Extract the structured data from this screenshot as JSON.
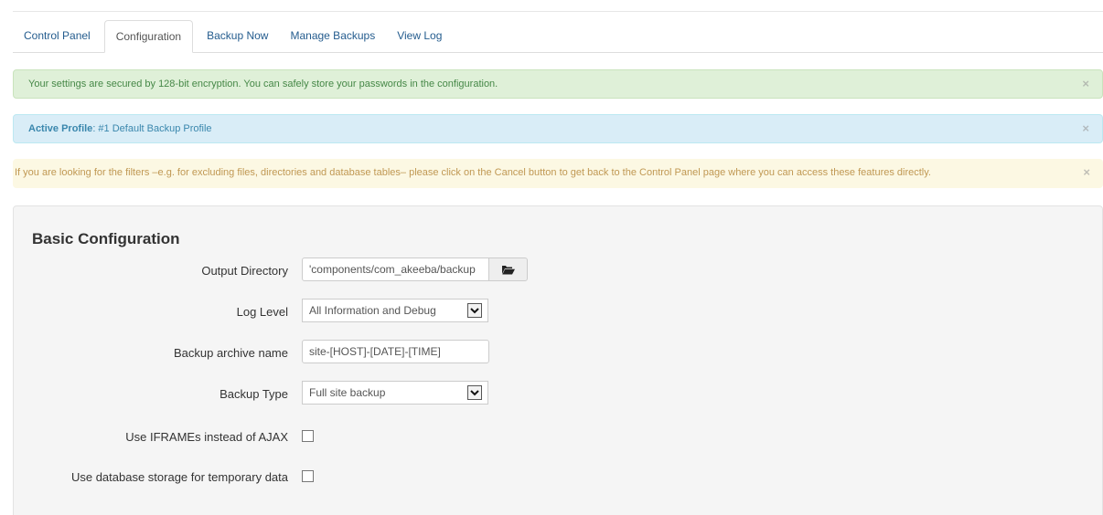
{
  "tabs": [
    {
      "label": "Control Panel"
    },
    {
      "label": "Configuration"
    },
    {
      "label": "Backup Now"
    },
    {
      "label": "Manage Backups"
    },
    {
      "label": "View Log"
    }
  ],
  "alerts": {
    "success": {
      "text": "Your settings are secured by 128-bit encryption. You can safely store your passwords in the configuration."
    },
    "info": {
      "label": "Active Profile",
      "text": ": #1 Default Backup Profile"
    },
    "warning": {
      "text": "If you are looking for the filters –e.g. for excluding files, directories and database tables– please click on the Cancel button to get back to the Control Panel page where you can access these features directly."
    },
    "close_glyph": "×"
  },
  "basic_config": {
    "title": "Basic Configuration",
    "output_directory": {
      "label": "Output Directory",
      "value": "'components/com_akeeba/backup"
    },
    "log_level": {
      "label": "Log Level",
      "value": "All Information and Debug"
    },
    "archive_name": {
      "label": "Backup archive name",
      "value": "site-[HOST]-[DATE]-[TIME]"
    },
    "backup_type": {
      "label": "Backup Type",
      "value": "Full site backup"
    },
    "use_iframes": {
      "label": "Use IFRAMEs instead of AJAX",
      "checked": false
    },
    "use_db_storage": {
      "label": "Use database storage for temporary data",
      "checked": false
    }
  },
  "colors": {
    "link": "#245c8e",
    "success_bg": "#dff0d8",
    "info_bg": "#d9edf7",
    "warning_bg": "#fcf8e3"
  },
  "icons": {
    "folder": "folder-open-icon",
    "dropdown": "chevron-down-icon",
    "close": "close-icon"
  }
}
